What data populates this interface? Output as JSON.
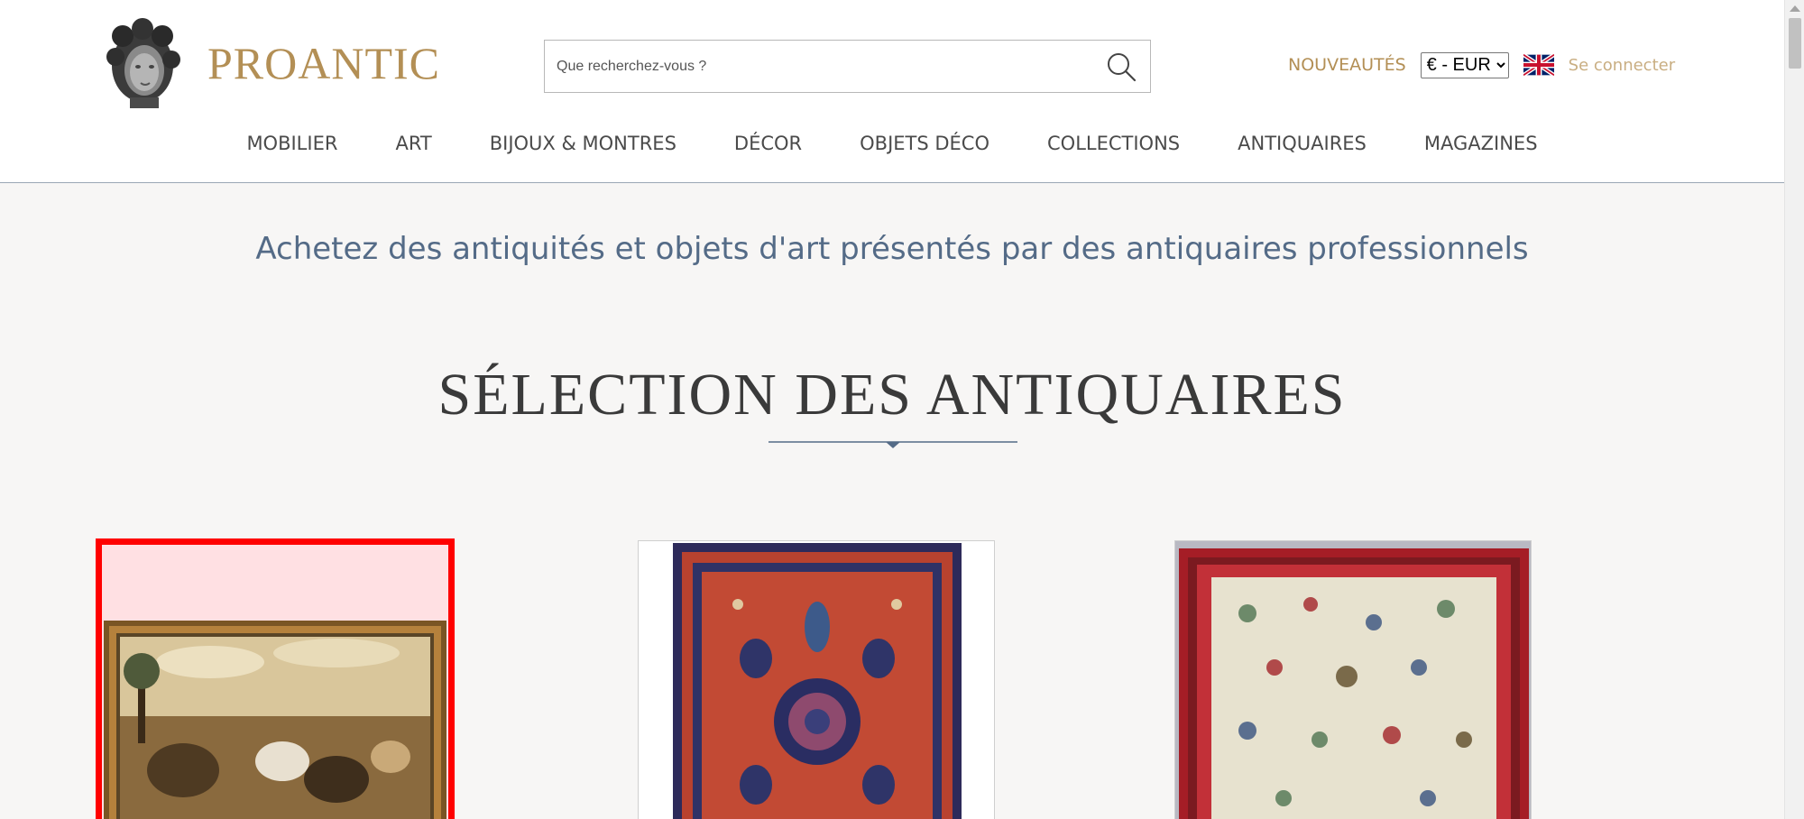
{
  "header": {
    "logo_text": "PROANTIC",
    "search": {
      "placeholder": "Que recherchez-vous ?"
    },
    "nouveautes_label": "NOUVEAUTÉS",
    "currency": {
      "selected": "€ - EUR",
      "options": [
        "€ - EUR"
      ]
    },
    "language_flag": "uk-flag-icon",
    "login_label": "Se connecter"
  },
  "nav": {
    "items": [
      {
        "label": "MOBILIER"
      },
      {
        "label": "ART"
      },
      {
        "label": "BIJOUX & MONTRES"
      },
      {
        "label": "DÉCOR"
      },
      {
        "label": "OBJETS DÉCO"
      },
      {
        "label": "COLLECTIONS"
      },
      {
        "label": "ANTIQUAIRES"
      },
      {
        "label": "MAGAZINES"
      }
    ]
  },
  "main": {
    "tagline": "Achetez des antiquités et objets d'art présentés par des antiquaires professionnels",
    "section_title": "SÉLECTION DES ANTIQUAIRES"
  },
  "colors": {
    "gold": "#b38f55",
    "tagline_blue": "#546b87",
    "highlight_red": "#ff0000"
  }
}
